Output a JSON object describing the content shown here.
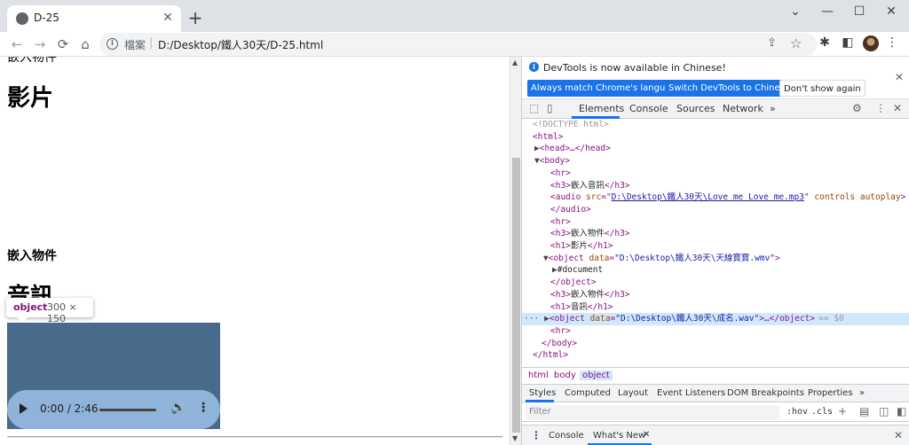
{
  "window": {
    "tab_title": "D-25",
    "tab_close": "✕",
    "new_tab": "+",
    "minimize": "⌄",
    "restore": "—",
    "maximize": "☐",
    "close": "✕"
  },
  "toolbar": {
    "back": "←",
    "forward": "→",
    "reload": "⟳",
    "home": "⌂",
    "omnibox_label": "檔案",
    "omnibox_sep": "|",
    "url": "D:/Desktop/鐵人30天/D-25.html",
    "share": "⇪",
    "star": "☆",
    "extensions": "✱",
    "sidepanel": "◧",
    "menu": "⋮"
  },
  "page": {
    "cut_heading": "嵌入物件",
    "h1_video": "影片",
    "h3_embed": "嵌入物件",
    "h1_audio": "音訊",
    "tooltip_tag": "object",
    "tooltip_size": "300 × 150",
    "audio_time": "0:00 / 2:46",
    "audio_volume": "🔊",
    "audio_more": "⋮"
  },
  "devtools": {
    "info_text": "DevTools is now available in Chinese!",
    "btn_match": "Always match Chrome's language",
    "btn_switch": "Switch DevTools to Chinese",
    "btn_dont": "Don't show again",
    "info_close": "✕",
    "tabs": [
      "Elements",
      "Console",
      "Sources",
      "Network"
    ],
    "tabs_more": "»",
    "settings": "⚙",
    "menu": "⋮",
    "close": "✕",
    "dom": {
      "doctype": "<!DOCTYPE html>",
      "html_open": "<html>",
      "head": "<head>…</head>",
      "body_open": "<body>",
      "hr": "<hr>",
      "h3_audio": "嵌入音訊",
      "audio_src_attr": "src",
      "audio_src_val": "D:\\Desktop\\鐵人30天\\Love me Love me.mp3",
      "audio_rest": "controls autoplay",
      "audio_close": "</audio>",
      "h3_obj": "嵌入物件",
      "h1_video": "影片",
      "object_data_val": "\"D:\\Desktop\\鐵人30天\\天線寶寶.wmv\"",
      "document": "#document",
      "object_close": "</object>",
      "h1_audio": "音訊",
      "object2_data_val": "\"D:\\Desktop\\鐵人30天\\成名.wav\"",
      "sel_marker": "== $0",
      "sel_dots": "···",
      "body_close": "</body>",
      "html_close": "</html>"
    },
    "breadcrumbs": [
      "html",
      "body",
      "object"
    ],
    "styles_tabs": [
      "Styles",
      "Computed",
      "Layout",
      "Event Listeners",
      "DOM Breakpoints",
      "Properties"
    ],
    "styles_more": "»",
    "filter_placeholder": "Filter",
    "hov": ":hov",
    "cls": ".cls",
    "drawer_console": "Console",
    "drawer_whatsnew": "What's New",
    "drawer_x": "✕"
  }
}
